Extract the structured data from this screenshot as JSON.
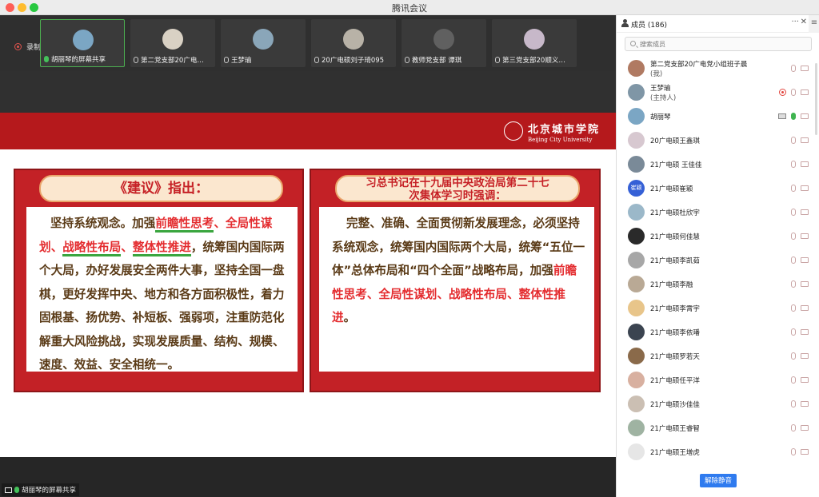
{
  "window": {
    "title": "腾讯会议"
  },
  "recording": {
    "label": "录制中"
  },
  "thumbnails": [
    {
      "label": "胡丽琴的屏幕共享",
      "active": true,
      "color": "#7ba6c4"
    },
    {
      "label": "第二党支部20广电…",
      "active": false,
      "color": "#d9d1c4"
    },
    {
      "label": "王梦瑜",
      "active": false,
      "color": "#8aa6b9"
    },
    {
      "label": "20广电硕刘子琦095",
      "active": false,
      "color": "#b8b2a7"
    },
    {
      "label": "教师党支部 谭琪",
      "active": false,
      "color": "#606060"
    },
    {
      "label": "第三党支部20顺义…",
      "active": false,
      "color": "#c7b8c9"
    }
  ],
  "slide": {
    "logo_cn": "北京城市学院",
    "logo_en": "Beijing City University",
    "left_panel": {
      "heading": "《建议》指出：",
      "lead": "坚持系统观念。加强",
      "hl1": "前瞻性思考",
      "sep1": "、",
      "hl2": "全局性谋划",
      "sep2": "、",
      "hl3": "战略性布局",
      "sep3": "、",
      "hl4": "整体性推进",
      "tail": "，统筹国内国际两个大局，办好发展安全两件大事，坚持全国一盘棋，更好发挥中央、地方和各方面积极性，着力固根基、扬优势、补短板、强弱项，注重防范化解重大风险挑战，实现发展质量、结构、规模、速度、效益、安全相统一。"
    },
    "right_panel": {
      "heading_line1": "习总书记在十九届中央政治局第二十七",
      "heading_line2": "次集体学习时强调：",
      "lead": "完整、准确、全面贯彻新发展理念，必须坚持系统观念，统筹国内国际两个大局，统筹“五位一体”总体布局和“四个全面”战略布局，加强",
      "hl1": "前瞻性思考",
      "sep1": "、",
      "hl2": "全局性谋划",
      "sep2": "、",
      "hl3": "战略性布局",
      "sep3": "、",
      "hl4": "整体性推进",
      "tail": "。"
    }
  },
  "share_label": "胡丽琴的屏幕共享",
  "members": {
    "title": "成员 (186)",
    "more": "···",
    "close": "✕",
    "side": "≡",
    "search_placeholder": "搜索成员",
    "unmute_button": "解除静音",
    "list": [
      {
        "name": "第二党支部20广电党小组班子晨",
        "sub": "(我)",
        "color": "#b07a62",
        "rec": false,
        "share": false,
        "mic_on": false
      },
      {
        "name": "王梦瑜",
        "sub": "(主持人)",
        "color": "#7f96a6",
        "rec": true,
        "share": false,
        "mic_on": false
      },
      {
        "name": "胡丽琴",
        "sub": "",
        "color": "#7ba6c4",
        "rec": false,
        "share": true,
        "mic_on": true
      },
      {
        "name": "20广电硕王鑫琪",
        "sub": "",
        "color": "#d7c8d0",
        "rec": false,
        "share": false,
        "mic_on": false
      },
      {
        "name": "21广电硕 王佳佳",
        "sub": "",
        "color": "#7a8a98",
        "rec": false,
        "share": false,
        "mic_on": false
      },
      {
        "name": "21广电硕崔颖",
        "sub": "",
        "color": "#3560d6",
        "text": "崔颖",
        "rec": false,
        "share": false,
        "mic_on": false
      },
      {
        "name": "21广电硕杜欣宇",
        "sub": "",
        "color": "#9bb8c9",
        "rec": false,
        "share": false,
        "mic_on": false
      },
      {
        "name": "21广电硕何佳慧",
        "sub": "",
        "color": "#2a2a2a",
        "rec": false,
        "share": false,
        "mic_on": false
      },
      {
        "name": "21广电硕李凯茹",
        "sub": "",
        "color": "#a7a7a7",
        "rec": false,
        "share": false,
        "mic_on": false
      },
      {
        "name": "21广电硕李融",
        "sub": "",
        "color": "#b9a995",
        "rec": false,
        "share": false,
        "mic_on": false
      },
      {
        "name": "21广电硕李霄宇",
        "sub": "",
        "color": "#e8c58a",
        "rec": false,
        "share": false,
        "mic_on": false
      },
      {
        "name": "21广电硕李依璠",
        "sub": "",
        "color": "#3b4450",
        "rec": false,
        "share": false,
        "mic_on": false
      },
      {
        "name": "21广电硕罗若天",
        "sub": "",
        "color": "#8a6a4a",
        "rec": false,
        "share": false,
        "mic_on": false
      },
      {
        "name": "21广电硕任平洋",
        "sub": "",
        "color": "#d8b0a0",
        "rec": false,
        "share": false,
        "mic_on": false
      },
      {
        "name": "21广电硕沙佳佳",
        "sub": "",
        "color": "#cbbfb3",
        "rec": false,
        "share": false,
        "mic_on": false
      },
      {
        "name": "21广电硕王睿智",
        "sub": "",
        "color": "#9fb3a2",
        "rec": false,
        "share": false,
        "mic_on": false
      },
      {
        "name": "21广电硕王增虎",
        "sub": "",
        "color": "#e6e6e6",
        "rec": false,
        "share": false,
        "mic_on": false
      }
    ]
  }
}
